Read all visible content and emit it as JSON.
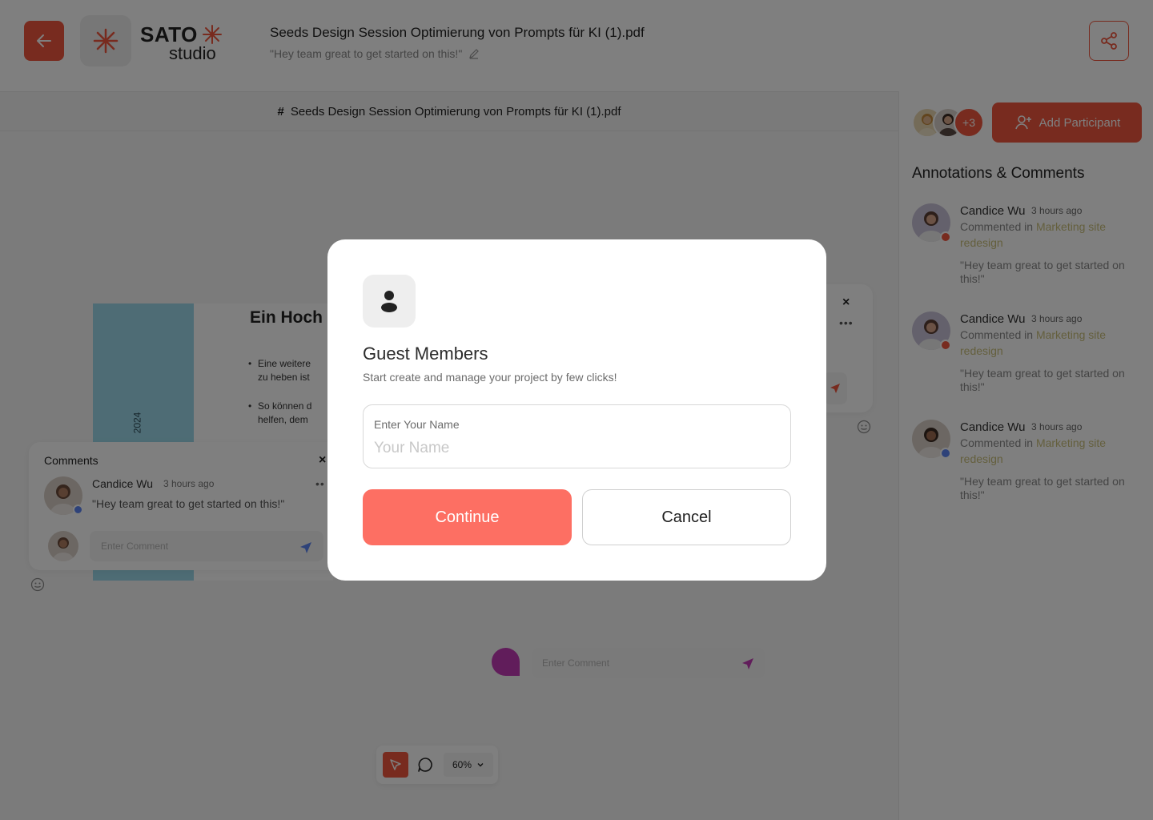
{
  "header": {
    "brand": {
      "name": "SATO",
      "sub": "studio"
    },
    "doc_title": "Seeds Design Session Optimierung von Prompts für KI (1).pdf",
    "doc_subtitle": "\"Hey team great to get started on this!\"",
    "icons": {
      "back": "arrow-left-icon",
      "logo": "asterisk-logo-icon",
      "edit": "pencil-icon",
      "share": "share-icon"
    }
  },
  "tabbar": {
    "hash": "#",
    "label": "Seeds Design Session Optimierung von Prompts für KI (1).pdf"
  },
  "page_preview": {
    "heading": "Ein Hoch a",
    "year": "2024",
    "bullets": [
      "Eine weitere",
      "zu heben ist",
      "So können d",
      "helfen, dem"
    ]
  },
  "comments_card": {
    "title": "Comments",
    "close": "×",
    "more": "••",
    "author": "Candice Wu",
    "time": "3 hours ago",
    "text": "\"Hey team great to get started on this!\"",
    "input_placeholder": "Enter Comment"
  },
  "right_card": {
    "close": "×",
    "more": "•••"
  },
  "pink_comment": {
    "input_placeholder": "Enter Comment"
  },
  "toolbar": {
    "zoom": "60%"
  },
  "sidebar": {
    "more_count": "+3",
    "add_participant_label": "Add Participant",
    "title": "Annotations & Comments",
    "items": [
      {
        "name": "Candice Wu",
        "time": "3 hours ago",
        "prefix": "Commented in",
        "link": "Marketing site redesign",
        "quote": "\"Hey team great to get started on this!\"",
        "status_color": "#f0573e"
      },
      {
        "name": "Candice Wu",
        "time": "3 hours ago",
        "prefix": "Commented in",
        "link": "Marketing site redesign",
        "quote": "\"Hey team great to get started on this!\"",
        "status_color": "#f0573e"
      },
      {
        "name": "Candice Wu",
        "time": "3 hours ago",
        "prefix": "Commented in",
        "link": "Marketing site redesign",
        "quote": "\"Hey team great to get started on this!\"",
        "status_color": "#5c85f2"
      }
    ]
  },
  "modal": {
    "title": "Guest Members",
    "subtitle": "Start create and manage your project by few clicks!",
    "field_label": "Enter Your Name",
    "field_placeholder": "Your Name",
    "field_value": "",
    "continue_label": "Continue",
    "cancel_label": "Cancel",
    "icon": "user-icon"
  },
  "colors": {
    "accent": "#f0573e",
    "continue": "#fd6f63",
    "link": "#c9bf7a",
    "page_bar": "#9cd9ea"
  }
}
